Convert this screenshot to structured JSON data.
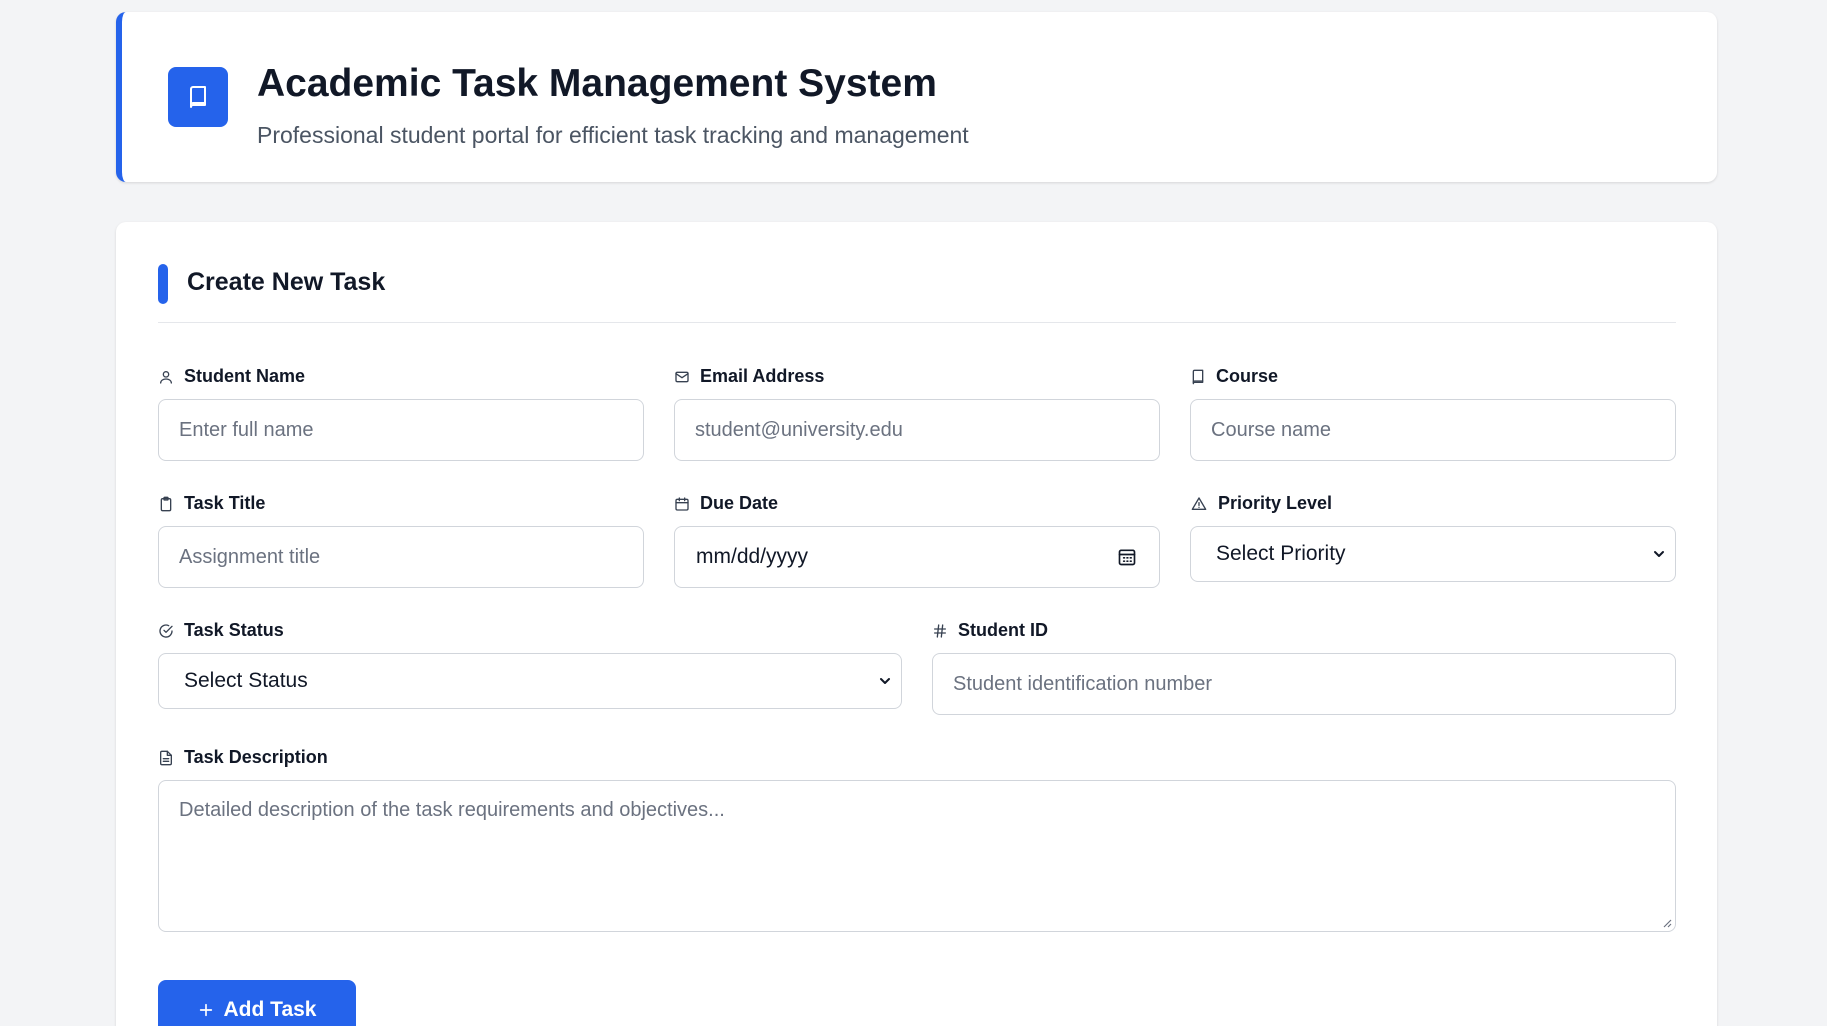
{
  "header": {
    "title": "Academic Task Management System",
    "subtitle": "Professional student portal for efficient task tracking and management",
    "logo_icon": "book-icon"
  },
  "form": {
    "section_title": "Create New Task",
    "fields": {
      "student_name": {
        "label": "Student Name",
        "placeholder": "Enter full name",
        "icon": "user-icon"
      },
      "email": {
        "label": "Email Address",
        "placeholder": "student@university.edu",
        "icon": "mail-icon"
      },
      "course": {
        "label": "Course",
        "placeholder": "Course name",
        "icon": "book-icon"
      },
      "task_title": {
        "label": "Task Title",
        "placeholder": "Assignment title",
        "icon": "clipboard-icon"
      },
      "due_date": {
        "label": "Due Date",
        "value": "mm/dd/yyyy",
        "icon": "calendar-icon"
      },
      "priority": {
        "label": "Priority Level",
        "selected": "Select Priority",
        "icon": "alert-triangle-icon"
      },
      "status": {
        "label": "Task Status",
        "selected": "Select Status",
        "icon": "check-circle-icon"
      },
      "student_id": {
        "label": "Student ID",
        "placeholder": "Student identification number",
        "icon": "hash-icon"
      },
      "description": {
        "label": "Task Description",
        "placeholder": "Detailed description of the task requirements and objectives...",
        "icon": "file-text-icon"
      }
    },
    "submit_label": "Add Task"
  },
  "colors": {
    "accent": "#2563eb",
    "background": "#f3f4f6",
    "card": "#ffffff",
    "border": "#d1d5db",
    "text": "#111827",
    "muted": "#4b5563"
  }
}
